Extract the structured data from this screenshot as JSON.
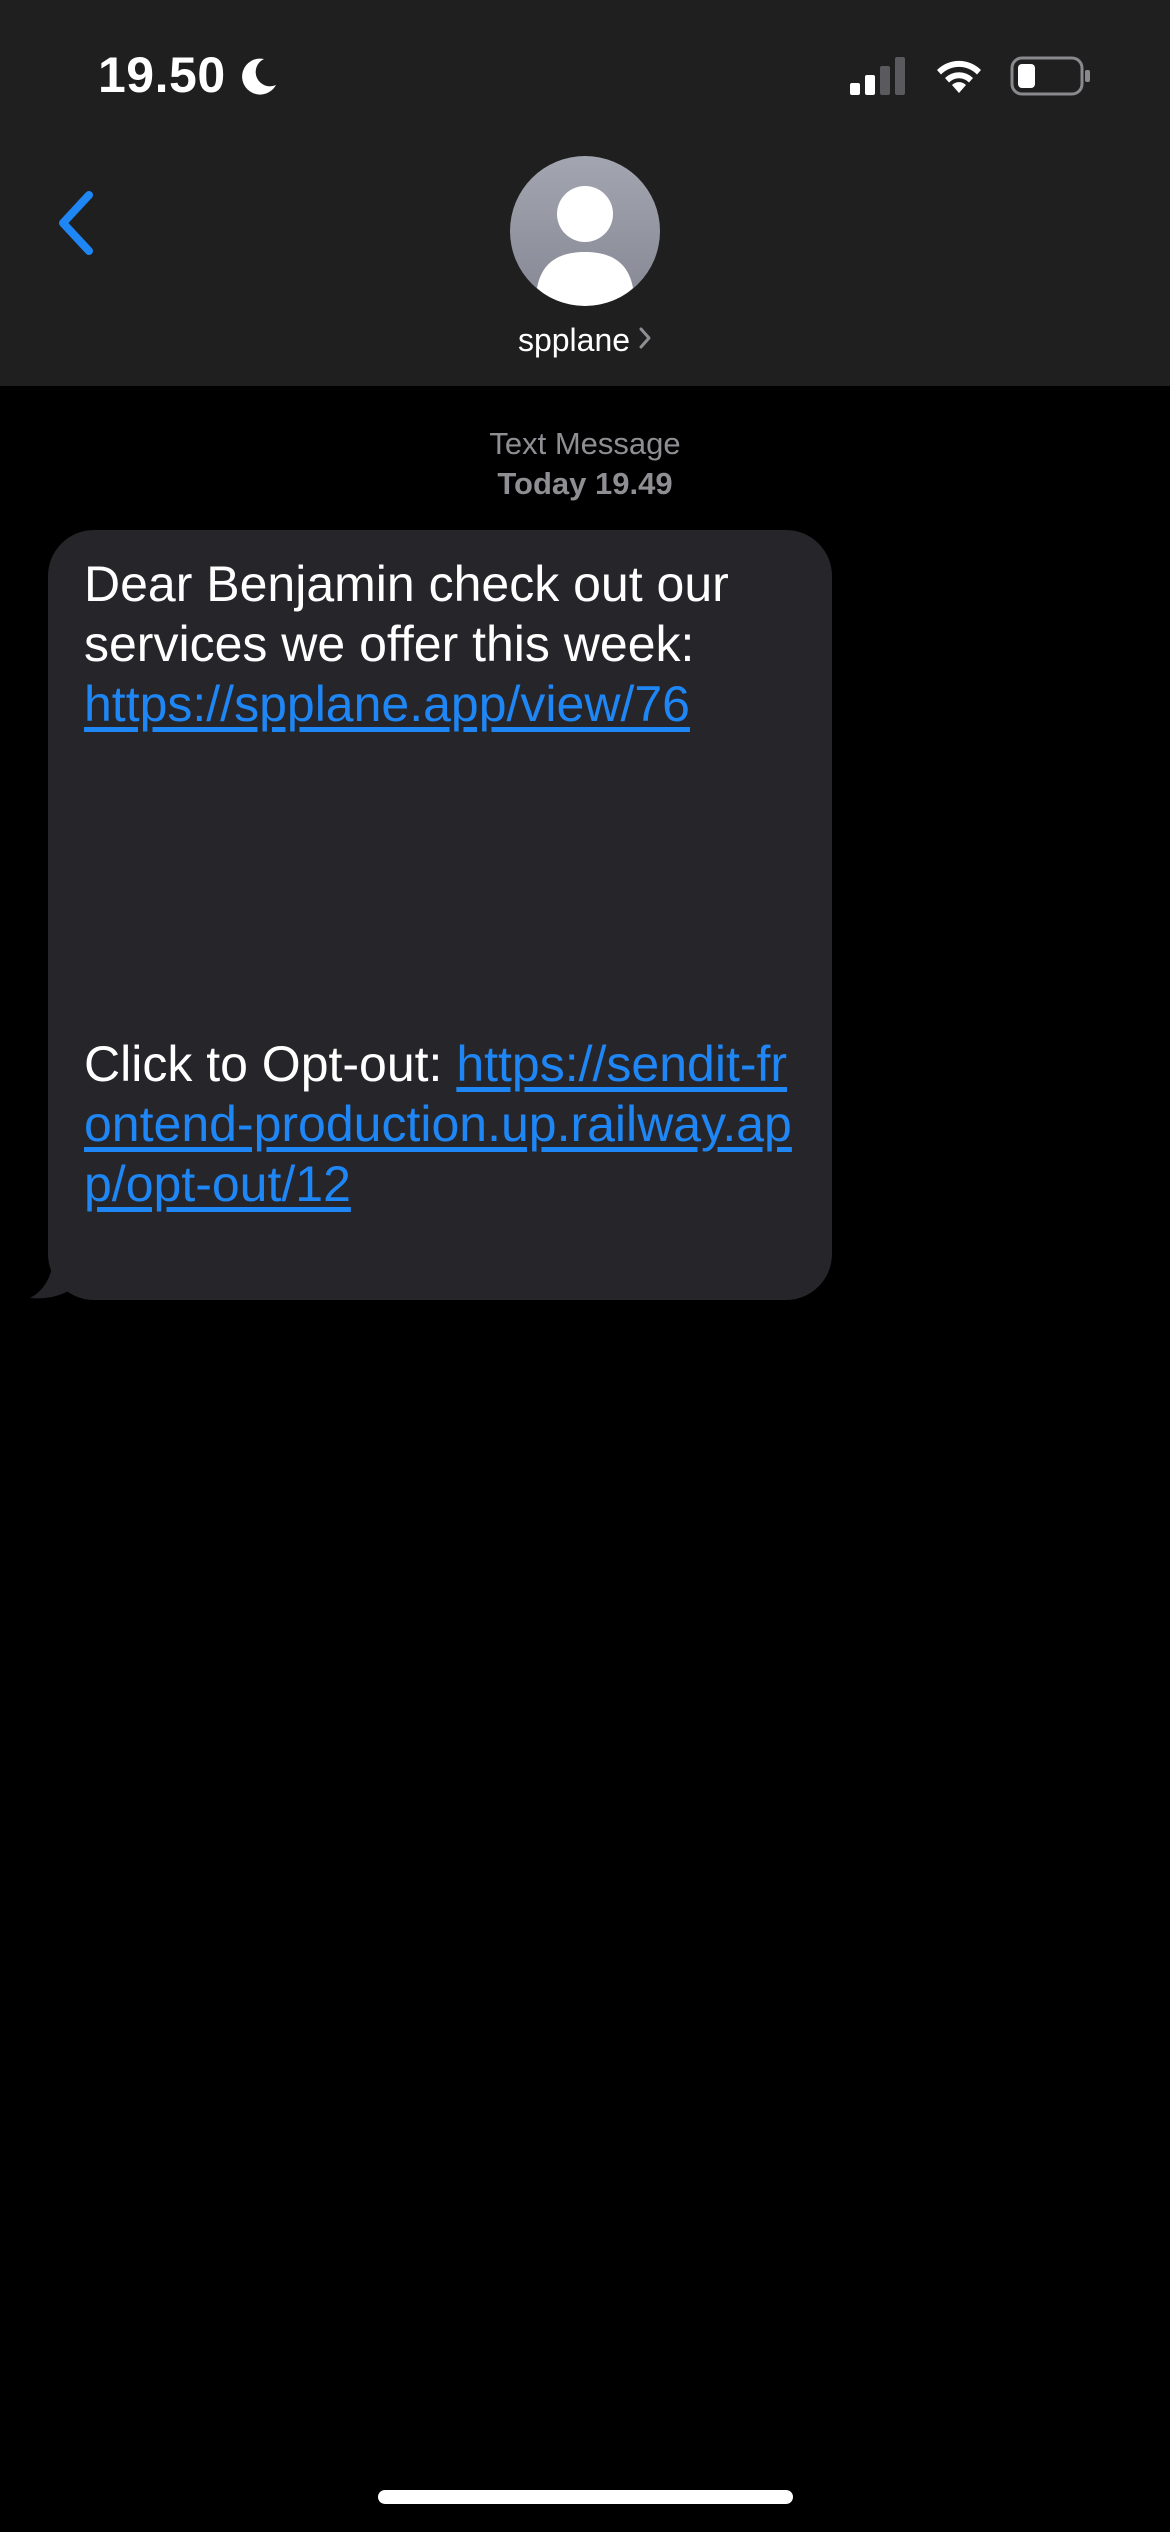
{
  "status_bar": {
    "time": "19.50",
    "icons": [
      "moon-icon",
      "cellular-signal-icon",
      "wifi-icon",
      "battery-icon"
    ],
    "battery_level": 0.25
  },
  "header": {
    "back_icon": "chevron-left-icon",
    "contact_name": "spplane",
    "avatar_icon": "person-silhouette-icon",
    "disclosure_icon": "chevron-right-icon"
  },
  "conversation": {
    "service_label": "Text Message",
    "timestamp": "Today 19.49",
    "messages": [
      {
        "direction": "incoming",
        "text_intro": "Dear  Benjamin check out our services we offer this week:",
        "link_1": "https://spplane.app/view/76",
        "optout_label": "Click to Opt-out: ",
        "link_2": "https://sendit-frontend-production.up.railway.app/opt-out/12"
      }
    ]
  },
  "colors": {
    "header_bg": "#1f1f1f",
    "page_bg": "#000000",
    "bubble_bg": "#26252a",
    "link": "#1f86f5",
    "accent": "#1f86f5",
    "meta_text": "#8e8e93"
  }
}
